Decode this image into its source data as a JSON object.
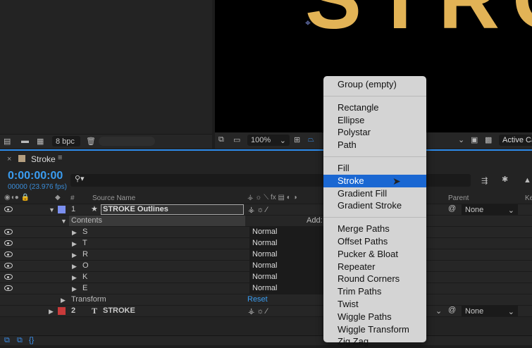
{
  "project_panel": {
    "bit_depth": "8 bpc"
  },
  "viewer": {
    "zoom": "100%",
    "camera": "Active Ca",
    "preview_text": "STRO",
    "text_color": "#e2b356"
  },
  "timeline": {
    "tab_title": "Stroke",
    "timecode": "0:00:00:00",
    "frame_info": "00000 (23.976 fps)",
    "columns": {
      "number": "#",
      "source_name": "Source Name",
      "parent": "Parent",
      "keys": "Ke"
    },
    "layer1": {
      "number": "1",
      "name": "STROKE Outlines",
      "label_color": "#7b8ff0",
      "parent": "None"
    },
    "contents": {
      "label": "Contents",
      "add_label": "Add:"
    },
    "groups": [
      {
        "name": "S",
        "mode": "Normal"
      },
      {
        "name": "T",
        "mode": "Normal"
      },
      {
        "name": "R",
        "mode": "Normal"
      },
      {
        "name": "O",
        "mode": "Normal"
      },
      {
        "name": "K",
        "mode": "Normal"
      },
      {
        "name": "E",
        "mode": "Normal"
      }
    ],
    "transform": {
      "label": "Transform",
      "reset": "Reset"
    },
    "layer2": {
      "number": "2",
      "name": "STROKE",
      "label_color": "#c83a3a",
      "parent": "None"
    }
  },
  "context_menu": {
    "sections": [
      [
        "Group (empty)"
      ],
      [
        "Rectangle",
        "Ellipse",
        "Polystar",
        "Path"
      ],
      [
        "Fill",
        "Stroke",
        "Gradient Fill",
        "Gradient Stroke"
      ],
      [
        "Merge Paths",
        "Offset Paths",
        "Pucker & Bloat",
        "Repeater",
        "Round Corners",
        "Trim Paths",
        "Twist",
        "Wiggle Paths",
        "Wiggle Transform",
        "Zig Zag"
      ]
    ],
    "highlighted": "Stroke",
    "highlight_color": "#1a67d2"
  }
}
